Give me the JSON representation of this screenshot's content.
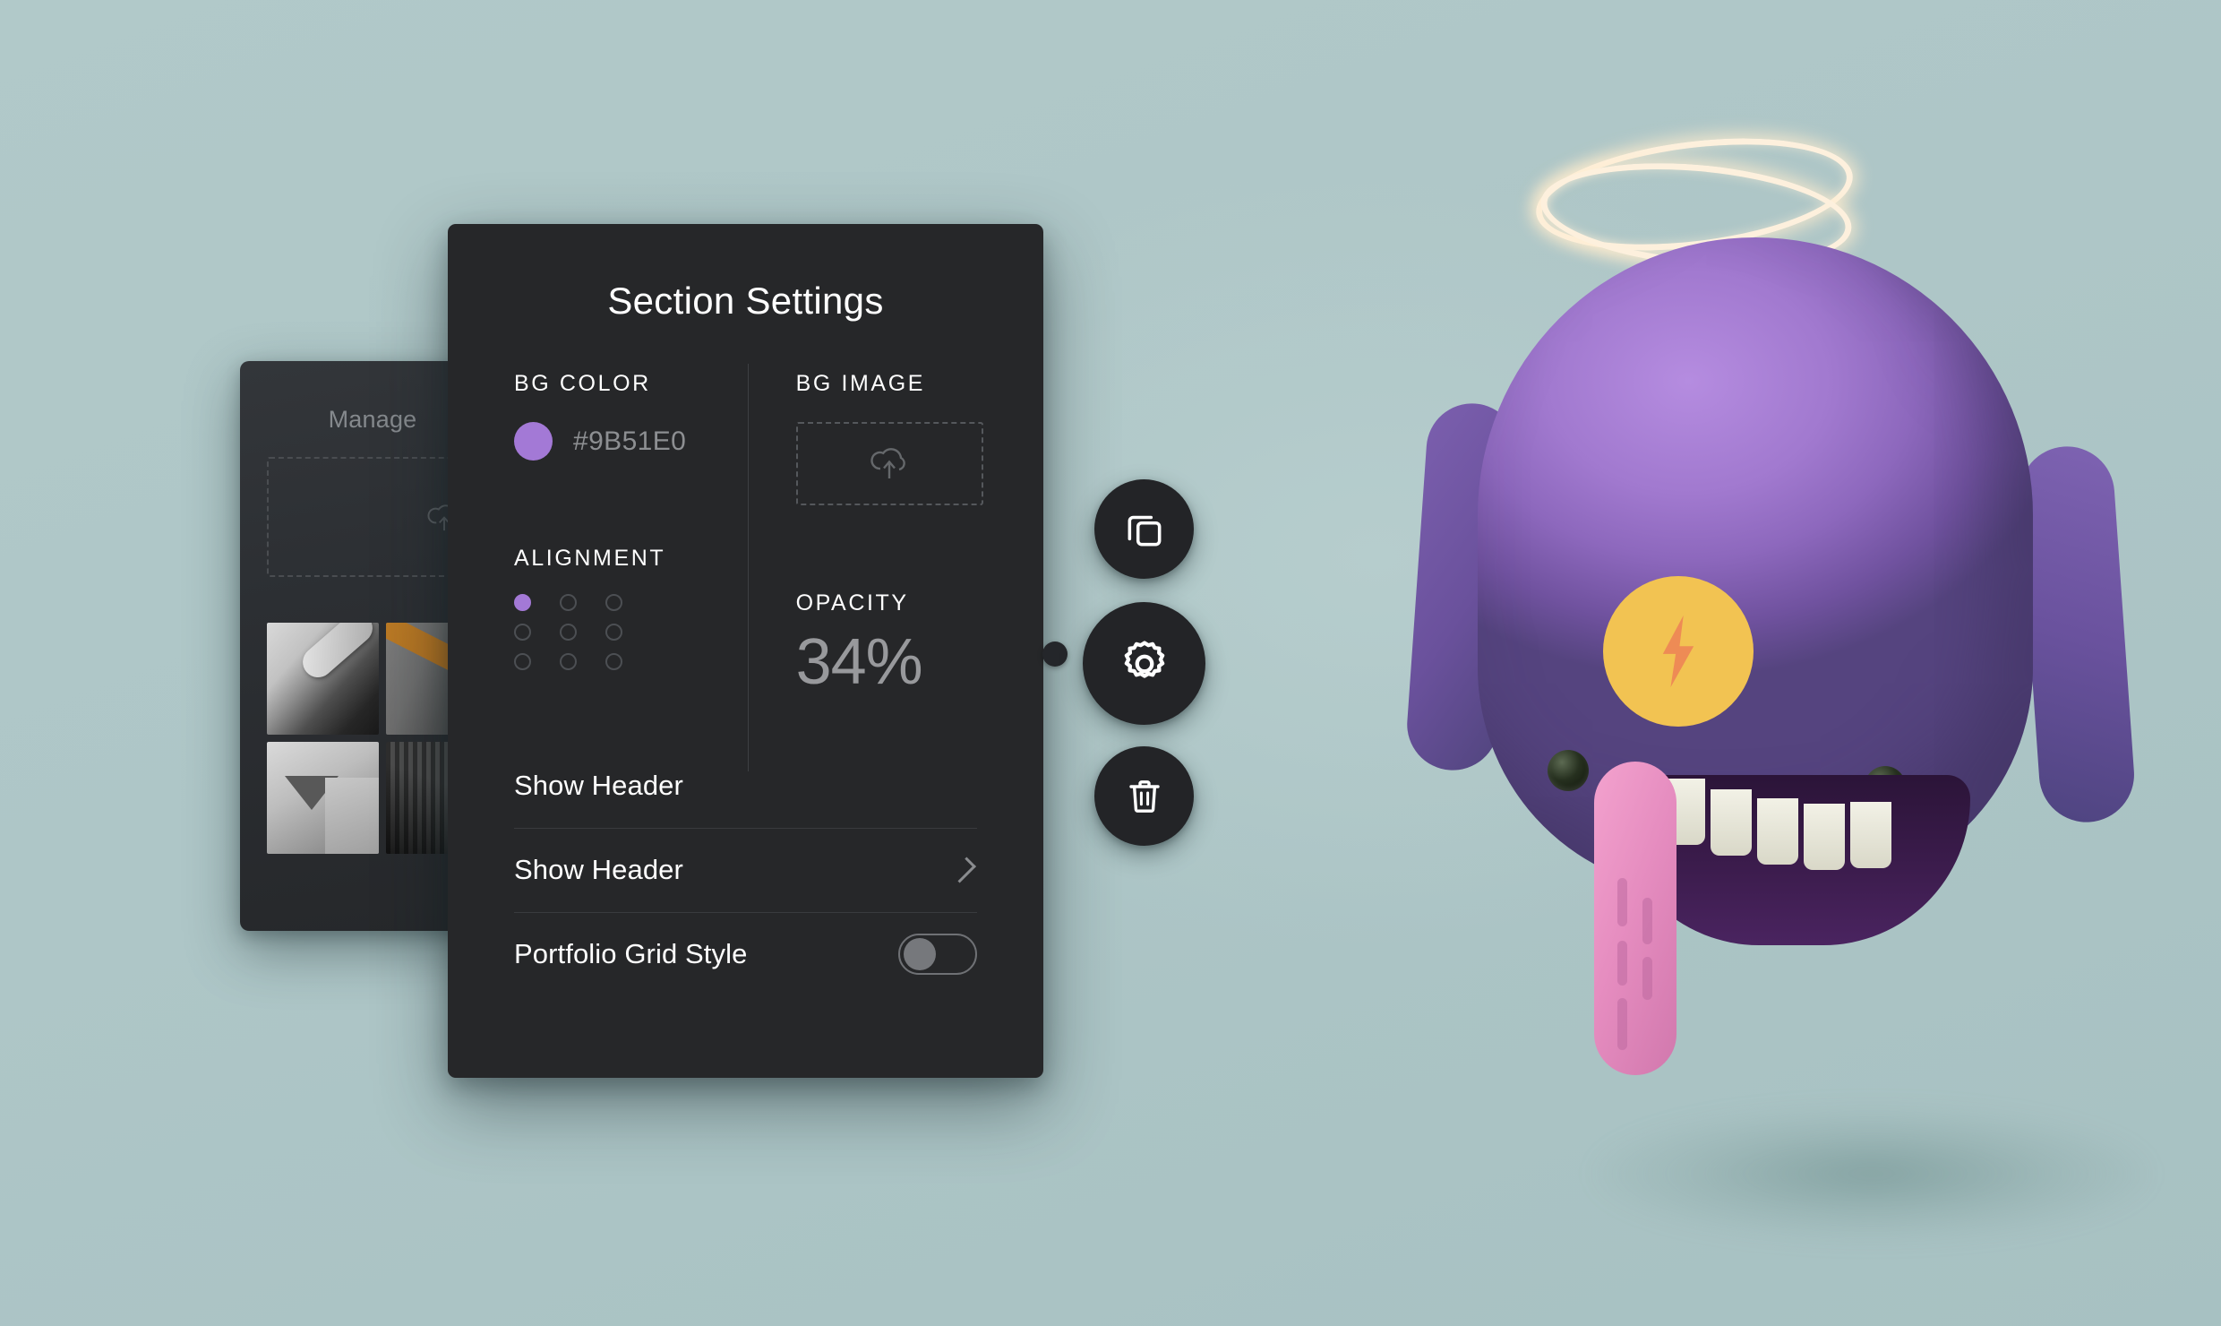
{
  "background": {
    "color": "#AEC7C8"
  },
  "bg_panel": {
    "title": "Manage",
    "dropzone_icon": "cloud-upload-icon",
    "thumbnails": [
      {
        "name": "thumbnail-1"
      },
      {
        "name": "thumbnail-2"
      },
      {
        "name": "thumbnail-3"
      },
      {
        "name": "thumbnail-4"
      }
    ]
  },
  "settings_panel": {
    "title": "Section Settings",
    "bg_color": {
      "label": "BG COLOR",
      "swatch_color": "#9B51E0",
      "hex_value": "#9B51E0"
    },
    "bg_image": {
      "label": "BG IMAGE",
      "upload_icon": "cloud-upload-icon"
    },
    "alignment": {
      "label": "ALIGNMENT",
      "selected_index": 0,
      "accent_color": "#9B51E0",
      "cells": [
        "align-top-left",
        "align-top-center",
        "align-top-right",
        "align-middle-left",
        "align-middle-center",
        "align-middle-right",
        "align-bottom-left",
        "align-bottom-center",
        "align-bottom-right"
      ]
    },
    "opacity": {
      "label": "OPACITY",
      "value": "34%"
    },
    "rows": [
      {
        "label": "Show Header",
        "control": "none"
      },
      {
        "label": "Show Header",
        "control": "chevron"
      },
      {
        "label": "Portfolio Grid Style",
        "control": "toggle",
        "toggle_state": "off"
      }
    ]
  },
  "action_buttons": [
    {
      "name": "duplicate-button",
      "icon": "duplicate-icon"
    },
    {
      "name": "settings-button",
      "icon": "gear-icon"
    },
    {
      "name": "delete-button",
      "icon": "trash-icon"
    }
  ],
  "mascot": {
    "name": "purple-mascot-character",
    "halo": "glowing-halo",
    "badge_icon": "lightning-bolt-icon",
    "body_color": "#9A76CC",
    "badge_color": "#F2C352",
    "bolt_color": "#EE8B55",
    "tongue_color": "#E58CBF"
  }
}
